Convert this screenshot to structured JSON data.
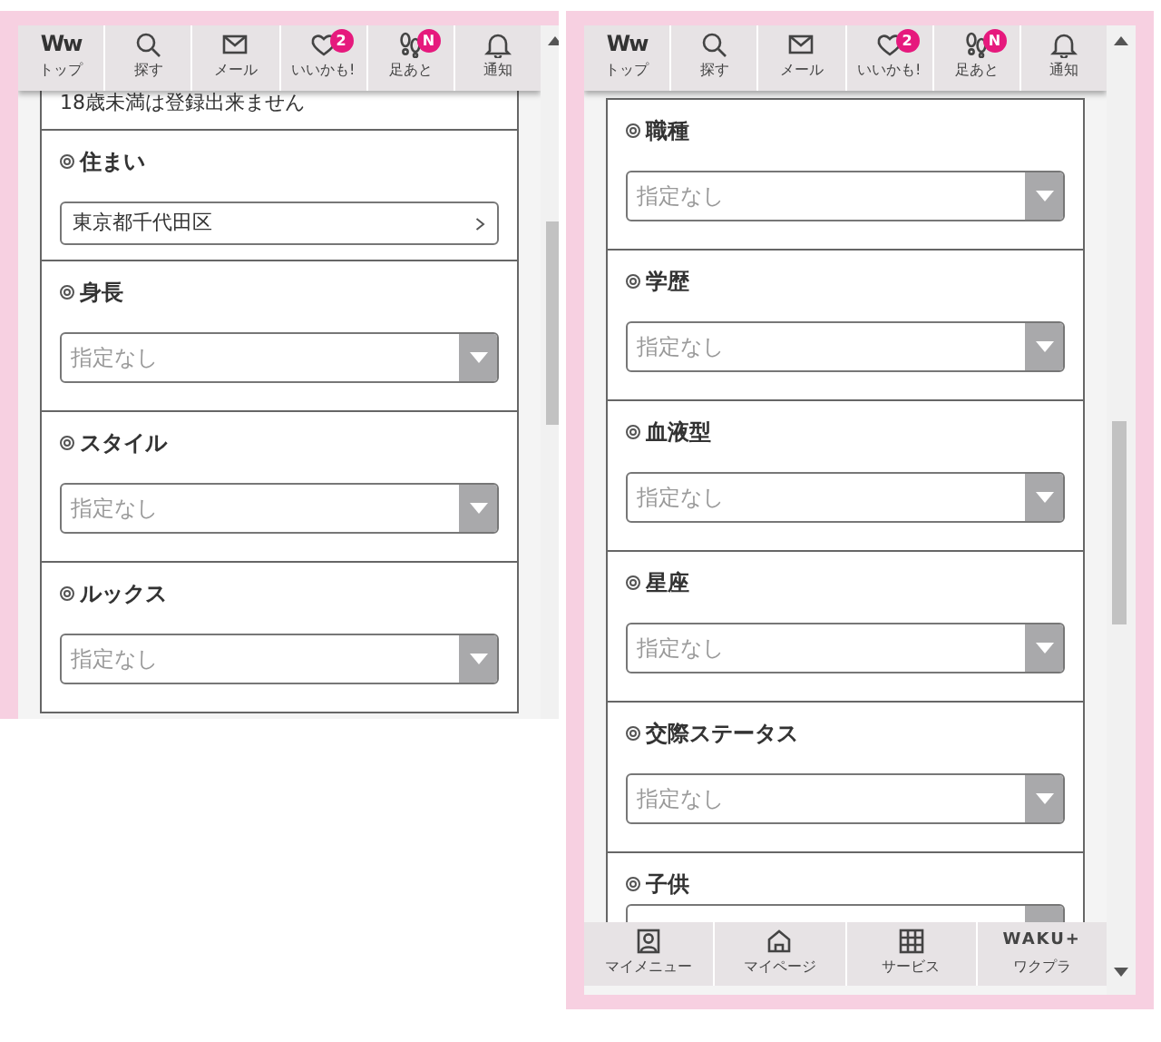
{
  "screens": [
    {
      "top_nav": [
        {
          "kind": "logo",
          "logo_text": "Ww",
          "label": "トップ"
        },
        {
          "kind": "search",
          "label": "探す"
        },
        {
          "kind": "mail",
          "label": "メール"
        },
        {
          "kind": "heart",
          "label": "いいかも!",
          "badge": "2"
        },
        {
          "kind": "footprints",
          "label": "足あと",
          "badge": "N"
        },
        {
          "kind": "bell",
          "label": "通知"
        }
      ],
      "notice": "18歳未満は登録出来ません",
      "fields": [
        {
          "kind": "link",
          "label": "住まい",
          "value": "東京都千代田区"
        },
        {
          "kind": "select",
          "label": "身長",
          "placeholder": "指定なし"
        },
        {
          "kind": "select",
          "label": "スタイル",
          "placeholder": "指定なし"
        },
        {
          "kind": "select",
          "label": "ルックス",
          "placeholder": "指定なし"
        }
      ]
    },
    {
      "top_nav": [
        {
          "kind": "logo",
          "logo_text": "Ww",
          "label": "トップ"
        },
        {
          "kind": "search",
          "label": "探す"
        },
        {
          "kind": "mail",
          "label": "メール"
        },
        {
          "kind": "heart",
          "label": "いいかも!",
          "badge": "2"
        },
        {
          "kind": "footprints",
          "label": "足あと",
          "badge": "N"
        },
        {
          "kind": "bell",
          "label": "通知"
        }
      ],
      "fields": [
        {
          "kind": "select",
          "label": "職種",
          "placeholder": "指定なし"
        },
        {
          "kind": "select",
          "label": "学歴",
          "placeholder": "指定なし"
        },
        {
          "kind": "select",
          "label": "血液型",
          "placeholder": "指定なし"
        },
        {
          "kind": "select",
          "label": "星座",
          "placeholder": "指定なし"
        },
        {
          "kind": "select",
          "label": "交際ステータス",
          "placeholder": "指定なし"
        },
        {
          "kind": "select",
          "label": "子供"
        }
      ],
      "bottom_nav": [
        {
          "kind": "profile",
          "label": "マイメニュー"
        },
        {
          "kind": "home",
          "label": "マイページ"
        },
        {
          "kind": "grid",
          "label": "サービス"
        },
        {
          "kind": "wordmark",
          "wordmark": "WAKU+",
          "label": "ワクプラ"
        }
      ]
    }
  ]
}
